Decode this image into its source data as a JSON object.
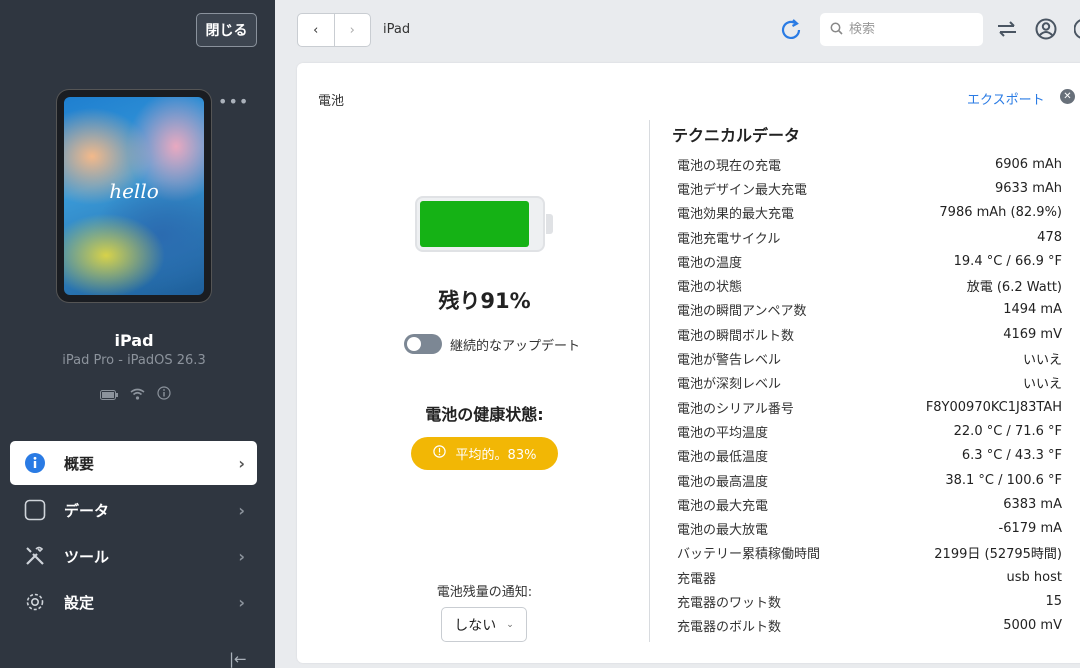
{
  "sidebar": {
    "close_label": "閉じる",
    "device_screen_text": "hello",
    "device_name": "iPad",
    "device_model": "iPad Pro - iPadOS 26.3",
    "nav": [
      {
        "label": "概要",
        "icon": "info-icon",
        "active": true
      },
      {
        "label": "データ",
        "icon": "square-icon",
        "active": false
      },
      {
        "label": "ツール",
        "icon": "tools-icon",
        "active": false
      },
      {
        "label": "設定",
        "icon": "gear-icon",
        "active": false
      }
    ]
  },
  "topbar": {
    "breadcrumb": "iPad",
    "search_placeholder": "検索"
  },
  "card": {
    "title": "電池",
    "export_label": "エクスポート",
    "battery_level": 0.91,
    "battery_color": "#15b215",
    "remaining_text": "残り91%",
    "toggle_label": "継続的なアップデート",
    "health_label": "電池の健康状態:",
    "health_badge": "平均的。83%",
    "health_color": "#f2b705",
    "notify_label": "電池残量の通知:",
    "notify_value": "しない",
    "tech_title": "テクニカルデータ",
    "tech_rows": [
      {
        "label": "電池の現在の充電",
        "value": "6906 mAh"
      },
      {
        "label": "電池デザイン最大充電",
        "value": "9633 mAh"
      },
      {
        "label": "電池効果的最大充電",
        "value": "7986 mAh (82.9%)"
      },
      {
        "label": "電池充電サイクル",
        "value": "478"
      },
      {
        "label": "電池の温度",
        "value": "19.4 °C / 66.9 °F"
      },
      {
        "label": "電池の状態",
        "value": "放電 (6.2 Watt)"
      },
      {
        "label": "電池の瞬間アンペア数",
        "value": "1494 mA"
      },
      {
        "label": "電池の瞬間ボルト数",
        "value": "4169 mV"
      },
      {
        "label": "電池が警告レベル",
        "value": "いいえ"
      },
      {
        "label": "電池が深刻レベル",
        "value": "いいえ"
      },
      {
        "label": "電池のシリアル番号",
        "value": "F8Y00970KC1J83TAH"
      },
      {
        "label": "電池の平均温度",
        "value": "22.0 °C / 71.6 °F"
      },
      {
        "label": "電池の最低温度",
        "value": "6.3 °C / 43.3 °F"
      },
      {
        "label": "電池の最高温度",
        "value": "38.1 °C / 100.6 °F"
      },
      {
        "label": "電池の最大充電",
        "value": "6383 mA"
      },
      {
        "label": "電池の最大放電",
        "value": "-6179 mA"
      },
      {
        "label": "バッテリー累積稼働時間",
        "value": "2199日 (52795時間)"
      },
      {
        "label": "充電器",
        "value": "usb host"
      },
      {
        "label": "充電器のワット数",
        "value": "15"
      },
      {
        "label": "充電器のボルト数",
        "value": "5000 mV"
      }
    ]
  }
}
